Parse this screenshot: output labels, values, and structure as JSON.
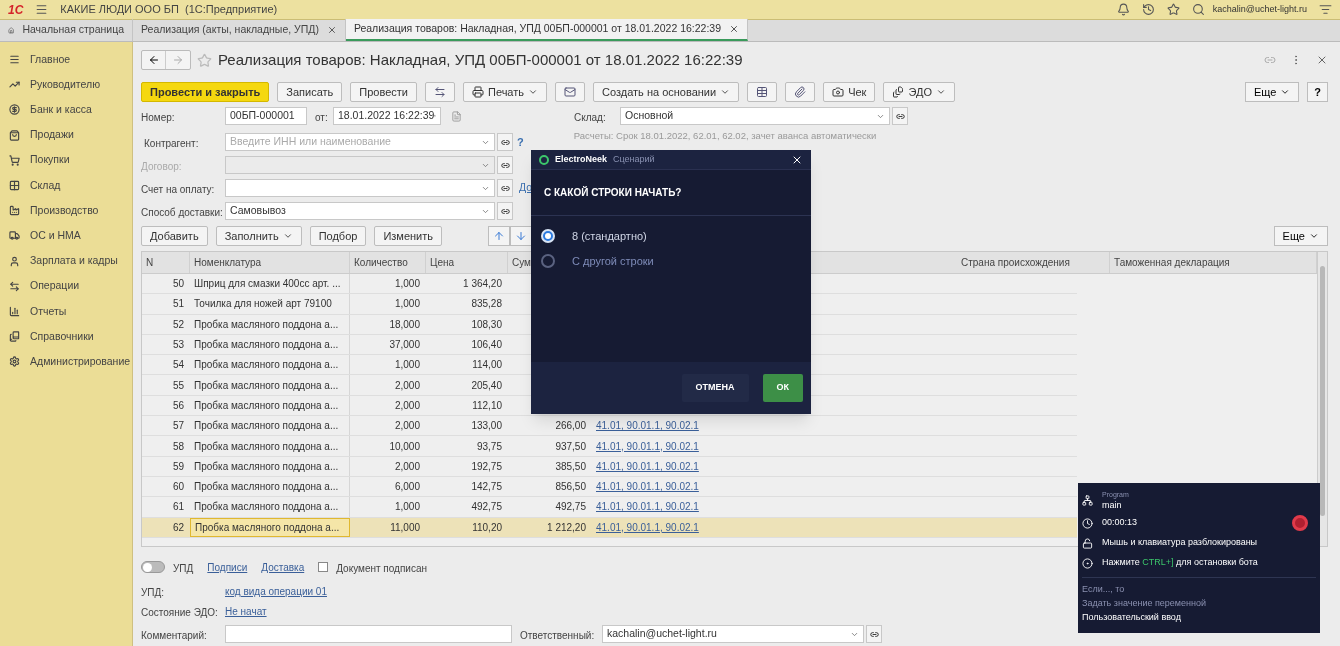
{
  "app": {
    "logo": "1С",
    "title": "КАКИЕ ЛЮДИ ООО БП  (1С:Предприятие)",
    "user": "kachalin@uchet-light.ru"
  },
  "tabs": [
    {
      "label": "Начальная страница",
      "kind": "home",
      "selected": false
    },
    {
      "label": "Реализация (акты, накладные, УПД)",
      "kind": "closable",
      "selected": false
    },
    {
      "label": "Реализация товаров: Накладная, УПД 00БП-000001 от 18.01.2022 16:22:39",
      "kind": "closable",
      "selected": true
    }
  ],
  "sidebar": {
    "items": [
      {
        "label": "Главное",
        "kind": "menu"
      },
      {
        "label": "Руководителю",
        "kind": "trend"
      },
      {
        "label": "Банк и касса",
        "kind": "bank"
      },
      {
        "label": "Продажи",
        "kind": "bag"
      },
      {
        "label": "Покупки",
        "kind": "cart"
      },
      {
        "label": "Склад",
        "kind": "grid"
      },
      {
        "label": "Производство",
        "kind": "factory"
      },
      {
        "label": "ОС и НМА",
        "kind": "truck"
      },
      {
        "label": "Зарплата и кадры",
        "kind": "user"
      },
      {
        "label": "Операции",
        "kind": "ops"
      },
      {
        "label": "Отчеты",
        "kind": "chart"
      },
      {
        "label": "Справочники",
        "kind": "book"
      },
      {
        "label": "Администрирование",
        "kind": "gear"
      }
    ]
  },
  "document": {
    "title": "Реализация товаров: Накладная, УПД 00БП-000001 от 18.01.2022 16:22:39",
    "toolbar": [
      {
        "kind": "primary",
        "label": "Провести и закрыть"
      },
      {
        "kind": "button",
        "label": "Записать"
      },
      {
        "kind": "button",
        "label": "Провести"
      },
      {
        "kind": "icon"
      },
      {
        "kind": "dropdown",
        "label": "Печать"
      },
      {
        "kind": "icon"
      },
      {
        "kind": "dropdown",
        "label": "Создать на основании"
      },
      {
        "kind": "icon"
      },
      {
        "kind": "icon"
      },
      {
        "kind": "button",
        "label": "Чек"
      },
      {
        "kind": "dropdown",
        "label": "ЭДО"
      }
    ],
    "more_button": "Еще",
    "help_button": "?",
    "number": {
      "label": "Номер:",
      "value": "00БП-000001",
      "date_label": "от:",
      "date": "18.01.2022 16:22:39"
    },
    "warehouse": {
      "label": "Склад:",
      "value": "Основной"
    },
    "counterparty": {
      "label": "Контрагент:",
      "placeholder": "Введите ИНН или наименование",
      "help": "?"
    },
    "settlements": "Расчеты: Срок 18.01.2022, 62.01, 62.02, зачет аванса автоматически",
    "contract": {
      "label": "Договор:",
      "disabled": true
    },
    "invoice": {
      "label": "Счет на оплату:",
      "link": "До"
    },
    "delivery": {
      "label": "Способ доставки:",
      "value": "Самовывоз"
    },
    "table_toolbar": [
      {
        "kind": "button",
        "label": "Добавить"
      },
      {
        "kind": "dropdown",
        "label": "Заполнить"
      },
      {
        "kind": "button",
        "label": "Подбор"
      },
      {
        "kind": "button",
        "label": "Изменить"
      }
    ],
    "table_more": "Еще",
    "table": {
      "columns": [
        "N",
        "Номенклатура",
        "Количество",
        "Цена",
        "Сум",
        "Страна происхождения",
        "Таможенная декларация"
      ],
      "rows": [
        {
          "n": "50",
          "item": "Шприц для смазки 400cc арт. ...",
          "qty": "1,000",
          "price": "1 364,20",
          "selected": false
        },
        {
          "n": "51",
          "item": "Точилка для ножей арт 79100",
          "qty": "1,000",
          "price": "835,28",
          "selected": false
        },
        {
          "n": "52",
          "item": "Пробка масляного поддона а...",
          "qty": "18,000",
          "price": "108,30",
          "selected": false
        },
        {
          "n": "53",
          "item": "Пробка масляного поддона а...",
          "qty": "37,000",
          "price": "106,40",
          "selected": false
        },
        {
          "n": "54",
          "item": "Пробка масляного поддона а...",
          "qty": "1,000",
          "price": "114,00",
          "selected": false
        },
        {
          "n": "55",
          "item": "Пробка масляного поддона а...",
          "qty": "2,000",
          "price": "205,40",
          "selected": false
        },
        {
          "n": "56",
          "item": "Пробка масляного поддона а...",
          "qty": "2,000",
          "price": "112,10",
          "selected": false
        },
        {
          "n": "57",
          "item": "Пробка масляного поддона а...",
          "qty": "2,000",
          "price": "133,00",
          "sum": "266,00",
          "accounts": "41.01, 90.01.1, 90.02.1",
          "selected": false
        },
        {
          "n": "58",
          "item": "Пробка масляного поддона а...",
          "qty": "10,000",
          "price": "93,75",
          "sum": "937,50",
          "accounts": "41.01, 90.01.1, 90.02.1",
          "selected": false
        },
        {
          "n": "59",
          "item": "Пробка масляного поддона а...",
          "qty": "2,000",
          "price": "192,75",
          "sum": "385,50",
          "accounts": "41.01, 90.01.1, 90.02.1",
          "selected": false
        },
        {
          "n": "60",
          "item": "Пробка масляного поддона а...",
          "qty": "6,000",
          "price": "142,75",
          "sum": "856,50",
          "accounts": "41.01, 90.01.1, 90.02.1",
          "selected": false
        },
        {
          "n": "61",
          "item": "Пробка масляного поддона а...",
          "qty": "1,000",
          "price": "492,75",
          "sum": "492,75",
          "accounts": "41.01, 90.01.1, 90.02.1",
          "selected": false
        },
        {
          "n": "62",
          "item": "Пробка масляного поддона а...",
          "qty": "11,000",
          "price": "110,20",
          "sum": "1 212,20",
          "accounts": "41.01, 90.01.1, 90.02.1",
          "selected": true
        }
      ]
    },
    "upd_toggle": {
      "label": "УПД",
      "on": false
    },
    "links": [
      "Подписи",
      "Доставка"
    ],
    "signed": {
      "label": "Документ подписан",
      "checked": false
    },
    "upd": {
      "label": "УПД:",
      "link": "код вида операции 01"
    },
    "edo_state": {
      "label": "Состояние ЭДО:",
      "link": "Не начат"
    },
    "comment": {
      "label": "Комментарий:"
    },
    "responsible": {
      "label": "Ответственный:",
      "value": "kachalin@uchet-light.ru"
    }
  },
  "dialog": {
    "brand": "ElectroNeek",
    "subtitle": "Сценарий",
    "question": "С КАКОЙ СТРОКИ НАЧАТЬ?",
    "options": [
      {
        "label": "8 (стандартно)",
        "selected": true
      },
      {
        "label": "С другой строки",
        "selected": false
      }
    ],
    "cancel": "ОТМЕНА",
    "ok": "ОК"
  },
  "bot_panel": {
    "program_label": "Program",
    "program": "main",
    "timer": "00:00:13",
    "lock_status": "Мышь и клавиатура разблокированы",
    "hint_before": "Нажмите",
    "hint_key": "CTRL+]",
    "hint_after": "для остановки бота",
    "steps": [
      {
        "label": "Если..., то",
        "current": false
      },
      {
        "label": "Задать значение переменной",
        "current": false
      },
      {
        "label": "Пользовательский ввод",
        "current": true
      }
    ]
  }
}
